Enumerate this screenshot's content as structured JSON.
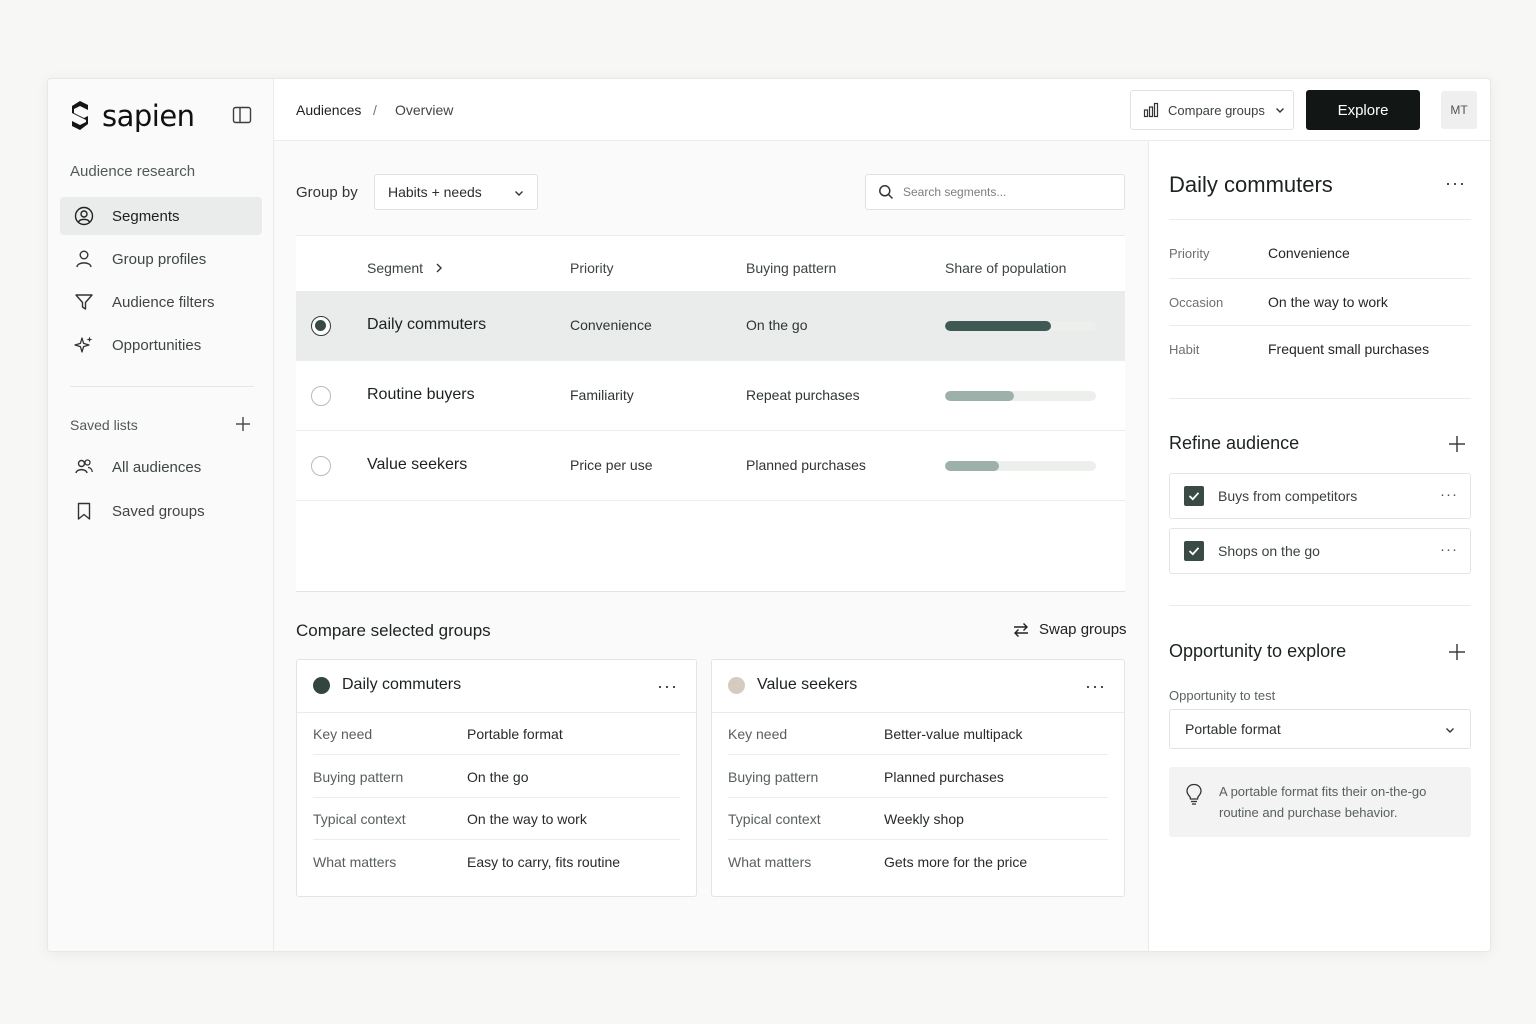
{
  "app": {
    "brand": "sapien"
  },
  "sidebar": {
    "section_label": "Audience research",
    "items": [
      {
        "label": "Segments",
        "icon": "user-circle-icon",
        "active": true
      },
      {
        "label": "Group profiles",
        "icon": "user-icon",
        "active": false
      },
      {
        "label": "Audience filters",
        "icon": "filter-icon",
        "active": false
      },
      {
        "label": "Opportunities",
        "icon": "sparkle-icon",
        "active": false
      }
    ],
    "saved_label": "Saved lists",
    "saved_items": [
      {
        "label": "All audiences",
        "icon": "users-icon"
      },
      {
        "label": "Saved groups",
        "icon": "bookmark-icon"
      }
    ]
  },
  "topbar": {
    "breadcrumb": [
      "Audiences",
      "Overview"
    ],
    "separator": "/",
    "compare_label": "Compare groups",
    "explore_label": "Explore",
    "avatar_initials": "MT"
  },
  "main": {
    "group_by_label": "Group by",
    "group_by_value": "Habits + needs",
    "search_placeholder": "Search segments...",
    "table": {
      "columns": [
        "Segment",
        "Priority",
        "Buying pattern",
        "Share of population"
      ],
      "rows": [
        {
          "name": "Daily commuters",
          "priority": "Convenience",
          "pattern": "On the go",
          "share": 0.7,
          "selected": true,
          "bar_color": "#3f5a54"
        },
        {
          "name": "Routine buyers",
          "priority": "Familiarity",
          "pattern": "Repeat purchases",
          "share": 0.46,
          "selected": false,
          "bar_color": "#9eb0aa"
        },
        {
          "name": "Value seekers",
          "priority": "Price per use",
          "pattern": "Planned purchases",
          "share": 0.36,
          "selected": false,
          "bar_color": "#9eb0aa"
        }
      ]
    },
    "compare": {
      "title": "Compare selected groups",
      "swap_label": "Swap groups",
      "cards": [
        {
          "name": "Daily commuters",
          "color": "#334541",
          "rows": [
            {
              "k": "Key need",
              "v": "Portable format"
            },
            {
              "k": "Buying pattern",
              "v": "On the go"
            },
            {
              "k": "Typical context",
              "v": "On the way to work"
            },
            {
              "k": "What matters",
              "v": "Easy to carry, fits routine"
            }
          ]
        },
        {
          "name": "Value seekers",
          "color": "#d6cbbf",
          "rows": [
            {
              "k": "Key need",
              "v": "Better-value multipack"
            },
            {
              "k": "Buying pattern",
              "v": "Planned purchases"
            },
            {
              "k": "Typical context",
              "v": "Weekly shop"
            },
            {
              "k": "What matters",
              "v": "Gets more for the price"
            }
          ]
        }
      ]
    }
  },
  "detail": {
    "title": "Daily commuters",
    "props": [
      {
        "k": "Priority",
        "v": "Convenience"
      },
      {
        "k": "Occasion",
        "v": "On the way to work"
      },
      {
        "k": "Habit",
        "v": "Frequent small purchases"
      }
    ],
    "refine_title": "Refine audience",
    "filters": [
      {
        "label": "Buys from competitors",
        "checked": true
      },
      {
        "label": "Shops on the go",
        "checked": true
      }
    ],
    "opportunity_title": "Opportunity to explore",
    "opportunity_label": "Opportunity to test",
    "opportunity_value": "Portable format",
    "note_line1": "A portable format fits their on-the-go",
    "note_line2": "routine and purchase behavior."
  },
  "colors": {
    "accent": "#3f5a54",
    "selected_row": "#e9ecea",
    "primary_button": "#121614"
  }
}
